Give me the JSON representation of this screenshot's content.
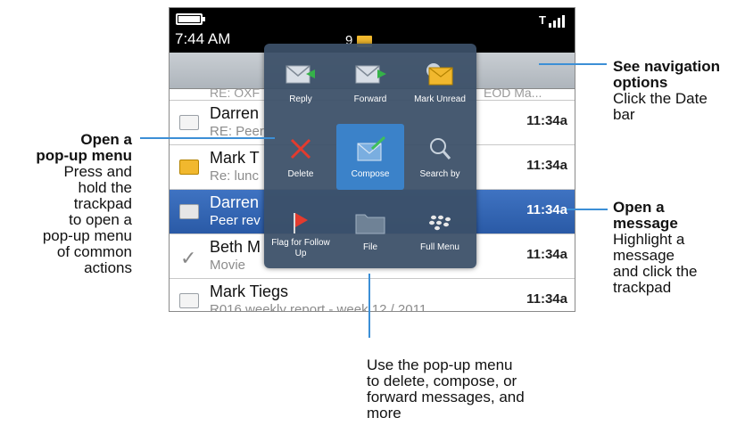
{
  "status": {
    "time": "7:44 AM",
    "count": "9"
  },
  "messages": [
    {
      "name": "RE: OXF",
      "partial_right": "EOD Ma..."
    },
    {
      "name": "Darren",
      "sub": "RE: Peer",
      "time": "11:34a"
    },
    {
      "name": "Mark T",
      "sub": "Re: lunc",
      "time": "11:34a"
    },
    {
      "name": "Darren",
      "sub": "Peer rev",
      "time": "11:34a"
    },
    {
      "name": "Beth M",
      "sub": "Movie",
      "time": "11:34a"
    },
    {
      "name": "Mark Tiegs",
      "sub": "R016 weekly report - week 12 / 2011",
      "time": "11:34a"
    }
  ],
  "popup": {
    "items": [
      {
        "label": "Reply",
        "icon": "reply-icon"
      },
      {
        "label": "Forward",
        "icon": "forward-icon"
      },
      {
        "label": "Mark Unread",
        "icon": "mark-unread-icon"
      },
      {
        "label": "Delete",
        "icon": "delete-icon"
      },
      {
        "label": "Compose",
        "icon": "compose-icon"
      },
      {
        "label": "Search by",
        "icon": "search-icon"
      },
      {
        "label": "Flag for Follow Up",
        "icon": "flag-icon"
      },
      {
        "label": "File",
        "icon": "folder-icon"
      },
      {
        "label": "Full Menu",
        "icon": "blackberry-icon"
      }
    ]
  },
  "callouts": {
    "popup": {
      "heading_1": "Open a",
      "heading_2": "pop-up menu",
      "body": [
        "Press and",
        "hold the",
        "trackpad",
        "to open a",
        "pop-up menu",
        "of common",
        "actions"
      ]
    },
    "navigation": {
      "heading_1": "See navigation",
      "heading_2": "options",
      "body": [
        "Click the Date",
        "bar"
      ]
    },
    "message": {
      "heading_1": "Open a",
      "heading_2": "message",
      "body": [
        "Highlight a",
        "message",
        "and click the",
        "trackpad"
      ]
    },
    "usage": {
      "body": [
        "Use the pop-up menu",
        "to delete, compose, or",
        "forward messages, and",
        "more"
      ]
    }
  },
  "colors": {
    "accent": "#3c8fd6",
    "highlight": "#2a5aa6",
    "popup": "#3c5068",
    "envelope": "#f1b82e"
  }
}
